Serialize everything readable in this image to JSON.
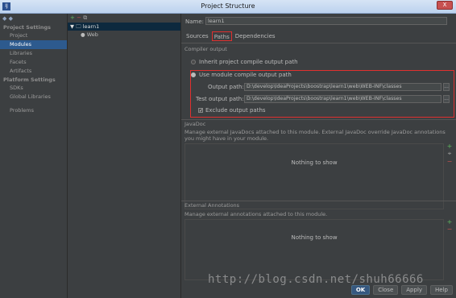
{
  "window": {
    "title": "Project Structure",
    "app_icon": "IJ",
    "close_label": "X"
  },
  "leftnav": {
    "toolbar": [
      "◆",
      "◆"
    ],
    "project_settings_label": "Project Settings",
    "project_items": [
      "Project",
      "Modules",
      "Libraries",
      "Facets",
      "Artifacts"
    ],
    "selected": "Modules",
    "platform_settings_label": "Platform Settings",
    "platform_items": [
      "SDKs",
      "Global Libraries"
    ],
    "problems_label": "Problems"
  },
  "tree": {
    "toolbar": {
      "add": "+",
      "remove": "−",
      "copy": "⧉"
    },
    "root": {
      "arrow": "▼",
      "label": "learn1"
    },
    "child": {
      "label": "Web"
    }
  },
  "content": {
    "name_label": "Name:",
    "name_value": "learn1",
    "tabs": [
      "Sources",
      "Paths",
      "Dependencies"
    ],
    "active_tab": "Paths",
    "compiler_output_label": "Compiler output",
    "inherit_option": "Inherit project compile output path",
    "use_module_option": "Use module compile output path",
    "output_path_label": "Output path:",
    "output_path_value": "D:\\develop\\IdeaProjects\\boostrap\\learn1\\web\\WEB-INF\\classes",
    "test_output_path_label": "Test output path:",
    "test_output_path_value": "D:\\develop\\IdeaProjects\\boostrap\\learn1\\web\\WEB-INF\\classes",
    "browse": "...",
    "exclude_label": "Exclude output paths",
    "javadoc_label": "JavaDoc",
    "javadoc_desc": "Manage external JavaDocs attached to this module. External JavaDoc override JavaDoc annotations you might have in your module.",
    "javadoc_empty": "Nothing to show",
    "external_annotations_label": "External Annotations",
    "external_annotations_desc": "Manage external annotations attached to this module.",
    "external_annotations_empty": "Nothing to show",
    "tools": {
      "add": "+",
      "remove": "−",
      "edit": "⌖"
    }
  },
  "buttons": {
    "ok": "OK",
    "close": "Close",
    "apply": "Apply",
    "help": "Help"
  },
  "watermark": "http://blog.csdn.net/shuh66666",
  "colors": {
    "highlight_box": "#e0302f",
    "selection": "#2d5a8e",
    "background": "#3c3f41"
  }
}
